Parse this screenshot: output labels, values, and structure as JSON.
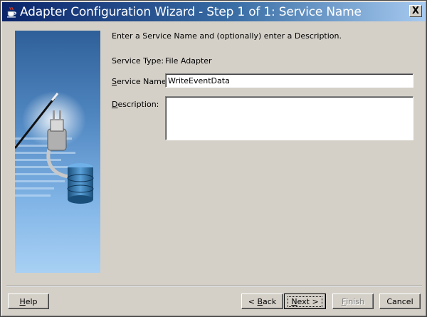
{
  "window": {
    "title": "Adapter Configuration Wizard - Step 1 of 1: Service Name",
    "close_label": "X"
  },
  "content": {
    "intro": "Enter a Service Name and (optionally) enter a Description.",
    "service_type_label": "Service Type:",
    "service_type_value": "File Adapter",
    "service_name_label_mnemonic": "S",
    "service_name_label_rest": "ervice Name:",
    "service_name_value": "WriteEventData",
    "description_label_mnemonic": "D",
    "description_label_rest": "escription:",
    "description_value": ""
  },
  "buttons": {
    "help_mnemonic": "H",
    "help_rest": "elp",
    "back_prefix": "< ",
    "back_mnemonic": "B",
    "back_rest": "ack",
    "next_mnemonic": "N",
    "next_rest": "ext >",
    "finish_mnemonic": "F",
    "finish_rest": "inish",
    "cancel_label": "Cancel"
  },
  "icons": {
    "title_icon": "java-cup-icon",
    "side_image": "plug-and-database-illustration"
  },
  "colors": {
    "titlebar_start": "#0a246a",
    "titlebar_end": "#a6caf0",
    "dialog_background": "#d4d0c8",
    "side_panel_top": "#2f5f98",
    "side_panel_bottom": "#9ec8f0"
  }
}
